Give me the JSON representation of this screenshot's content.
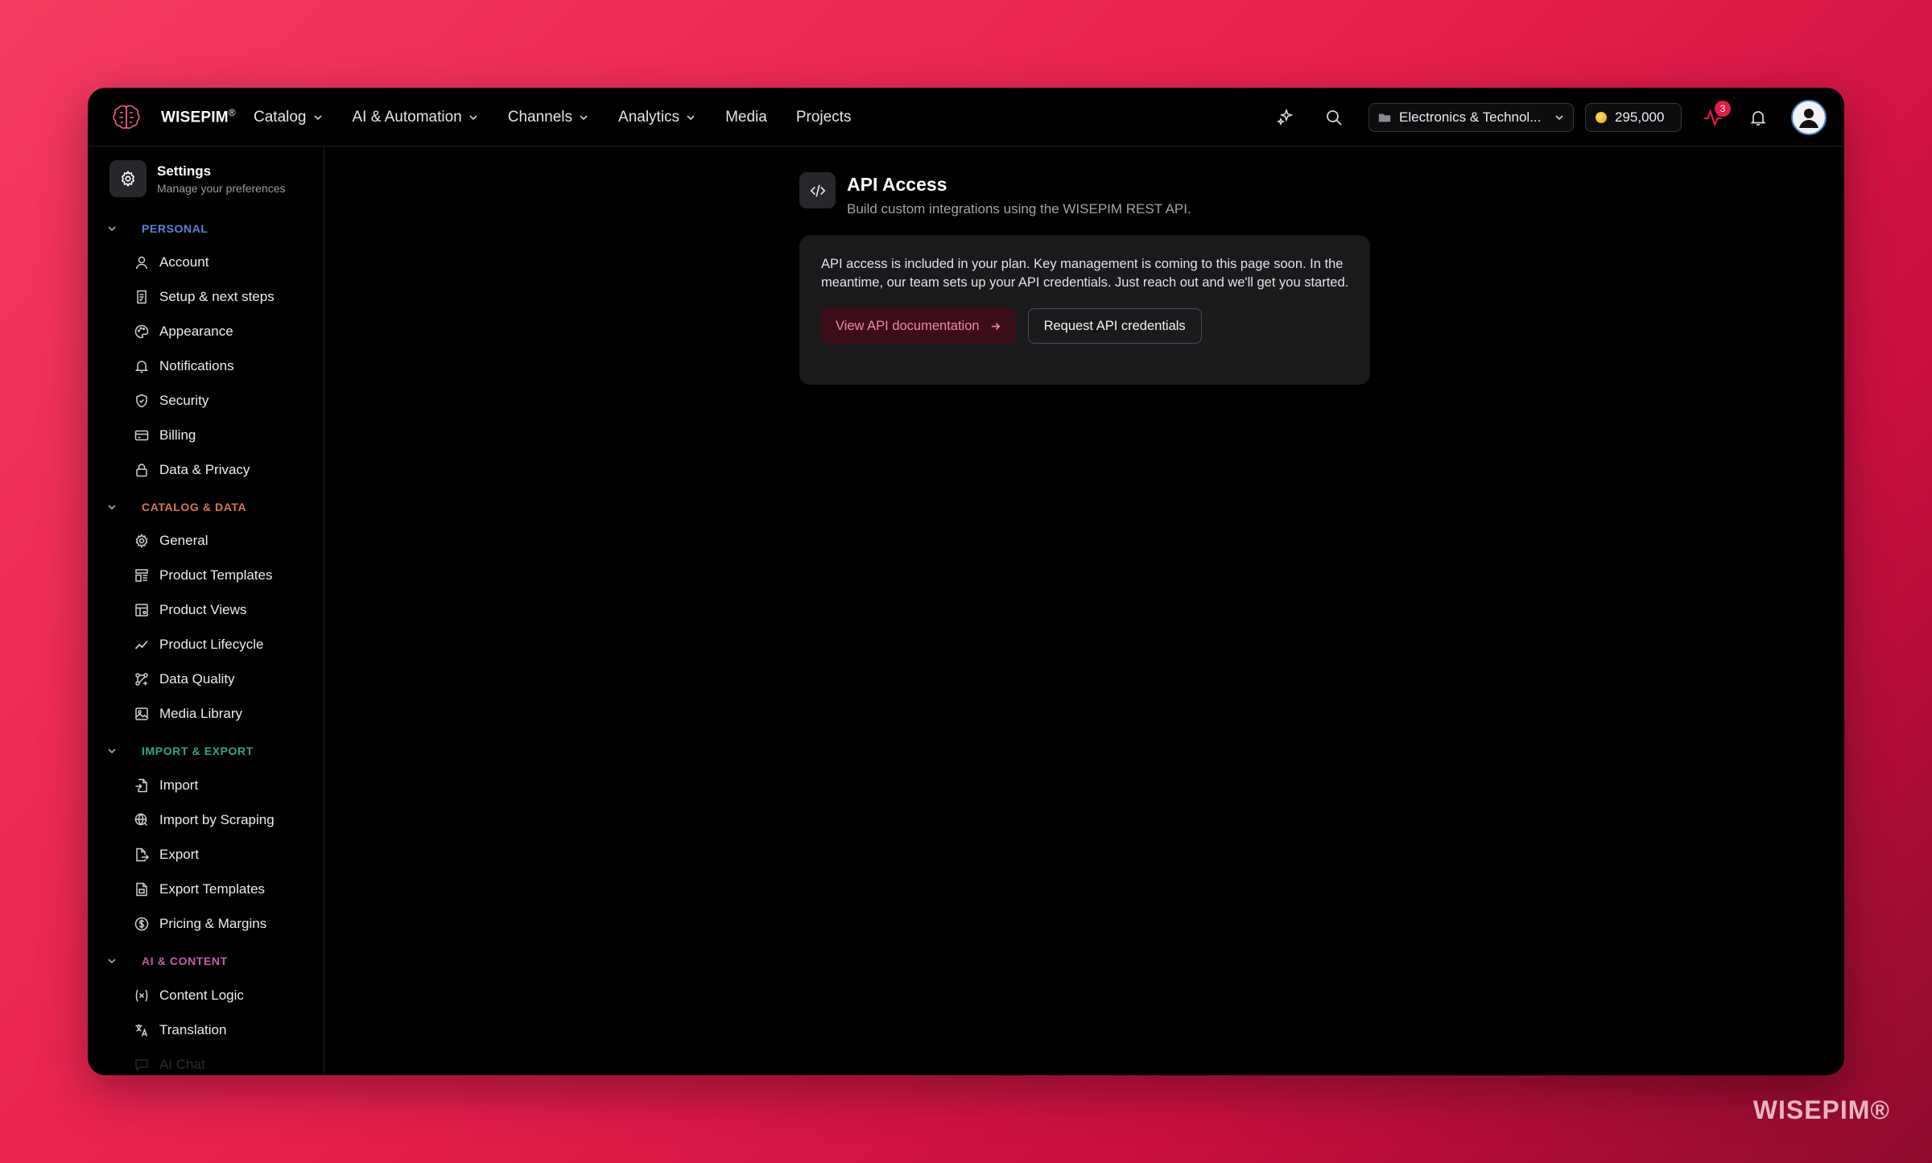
{
  "topbar": {
    "brand": "WISEPIM",
    "brand_mark": "®",
    "nav": [
      {
        "label": "Catalog",
        "has_dropdown": true
      },
      {
        "label": "AI & Automation",
        "has_dropdown": true
      },
      {
        "label": "Channels",
        "has_dropdown": true
      },
      {
        "label": "Analytics",
        "has_dropdown": true
      },
      {
        "label": "Media",
        "has_dropdown": false
      },
      {
        "label": "Projects",
        "has_dropdown": false
      }
    ],
    "workspace": "Electronics & Technol...",
    "credits": "295,000",
    "activity_badge": "3",
    "icons": [
      "sparkles-icon",
      "search-icon",
      "folder-icon",
      "coin-icon",
      "activity-icon",
      "bell-icon",
      "user-avatar"
    ]
  },
  "sidebar": {
    "title": "Settings",
    "subtitle": "Manage your preferences",
    "sections": [
      {
        "label": "PERSONAL",
        "color": "#5b7fd9",
        "items": [
          {
            "label": "Account",
            "icon": "user-icon"
          },
          {
            "label": "Setup & next steps",
            "icon": "checklist-icon"
          },
          {
            "label": "Appearance",
            "icon": "palette-icon"
          },
          {
            "label": "Notifications",
            "icon": "bell-icon"
          },
          {
            "label": "Security",
            "icon": "shield-icon"
          },
          {
            "label": "Billing",
            "icon": "credit-card-icon"
          },
          {
            "label": "Data & Privacy",
            "icon": "lock-icon"
          }
        ]
      },
      {
        "label": "CATALOG & DATA",
        "color": "#d9774a",
        "items": [
          {
            "label": "General",
            "icon": "gear-icon"
          },
          {
            "label": "Product Templates",
            "icon": "template-icon"
          },
          {
            "label": "Product Views",
            "icon": "table-icon"
          },
          {
            "label": "Product Lifecycle",
            "icon": "trend-icon"
          },
          {
            "label": "Data Quality",
            "icon": "workflow-icon"
          },
          {
            "label": "Media Library",
            "icon": "image-icon"
          }
        ]
      },
      {
        "label": "IMPORT & EXPORT",
        "color": "#2fa784",
        "items": [
          {
            "label": "Import",
            "icon": "file-import-icon"
          },
          {
            "label": "Import by Scraping",
            "icon": "globe-icon"
          },
          {
            "label": "Export",
            "icon": "file-export-icon"
          },
          {
            "label": "Export Templates",
            "icon": "file-template-icon"
          },
          {
            "label": "Pricing & Margins",
            "icon": "dollar-icon"
          }
        ]
      },
      {
        "label": "AI & CONTENT",
        "color": "#c05fa6",
        "items": [
          {
            "label": "Content Logic",
            "icon": "variable-icon"
          },
          {
            "label": "Translation",
            "icon": "translate-icon"
          },
          {
            "label": "AI Chat",
            "icon": "chat-icon"
          }
        ]
      }
    ]
  },
  "main": {
    "title": "API Access",
    "subtitle": "Build custom integrations using the WISEPIM REST API.",
    "card_text": "API access is included in your plan. Key management is coming to this page soon. In the meantime, our team sets up your API credentials. Just reach out and we'll get you started.",
    "primary_button": "View API documentation",
    "secondary_button": "Request API credentials"
  },
  "watermark": "WISEPIM®"
}
